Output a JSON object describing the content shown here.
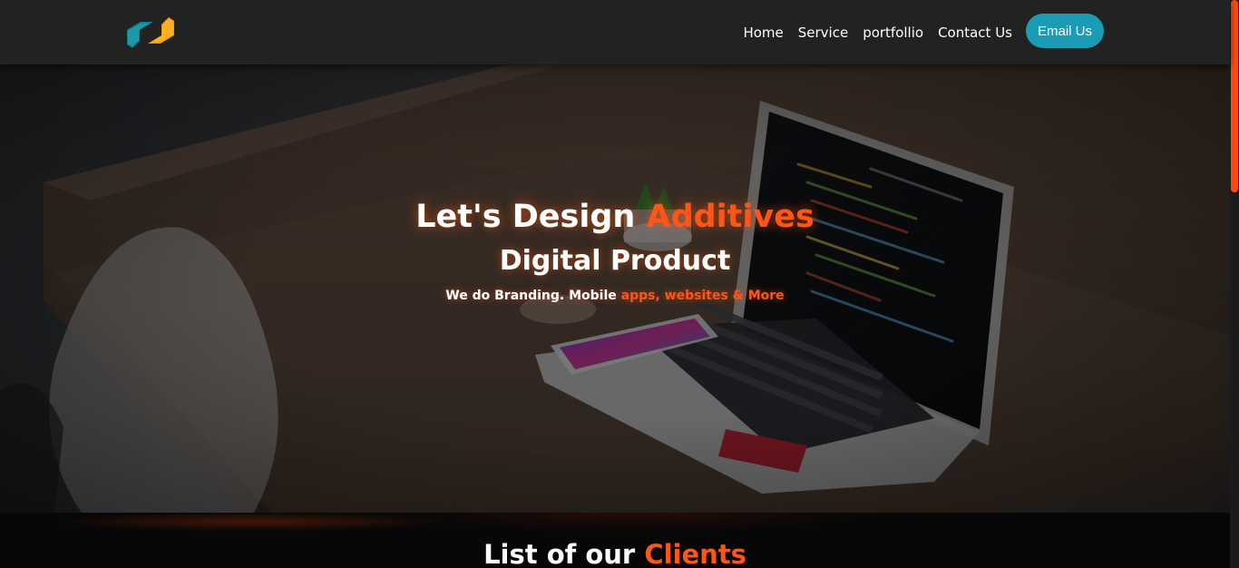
{
  "nav": {
    "logo_icon": "brand-logo-icon",
    "links": [
      "Home",
      "Service",
      "portfollio",
      "Contact Us"
    ],
    "cta_label": "Email Us",
    "cta_color": "#1a9cb4"
  },
  "hero": {
    "title_main": "Let's Design ",
    "title_accent": "Additives",
    "subtitle": "Digital Product",
    "tagline_main": "We do Branding. Mobile ",
    "tagline_accent": "apps, websites & More",
    "accent_color": "#ff5518"
  },
  "clients": {
    "title_main": "List of our ",
    "title_accent": "Clients"
  },
  "scrollbar": {
    "thumb_color": "#ff4a0e"
  }
}
